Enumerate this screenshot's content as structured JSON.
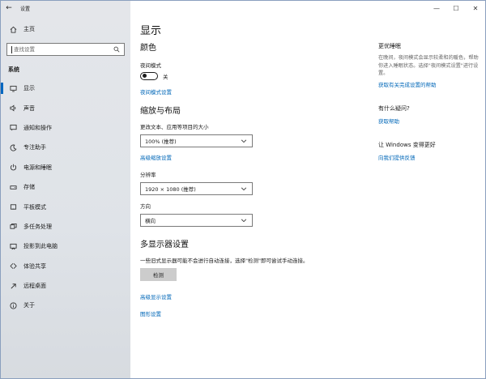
{
  "window": {
    "app_title": "设置",
    "controls": {
      "minimize": "—",
      "maximize": "☐",
      "close": "✕"
    }
  },
  "sidebar": {
    "back_glyph": "←",
    "home_label": "主页",
    "search": {
      "placeholder": "查找设置"
    },
    "section_label": "系统",
    "items": [
      {
        "label": "显示",
        "icon": "monitor-icon",
        "active": true
      },
      {
        "label": "声音",
        "icon": "speaker-icon"
      },
      {
        "label": "通知和操作",
        "icon": "notification-icon"
      },
      {
        "label": "专注助手",
        "icon": "moon-icon"
      },
      {
        "label": "电源和睡眠",
        "icon": "power-icon"
      },
      {
        "label": "存储",
        "icon": "storage-icon"
      },
      {
        "label": "平板模式",
        "icon": "tablet-icon"
      },
      {
        "label": "多任务处理",
        "icon": "multitask-icon"
      },
      {
        "label": "投影到此电脑",
        "icon": "project-icon"
      },
      {
        "label": "体验共享",
        "icon": "share-icon"
      },
      {
        "label": "远程桌面",
        "icon": "remote-icon"
      },
      {
        "label": "关于",
        "icon": "info-icon"
      }
    ]
  },
  "main": {
    "page_title": "显示",
    "color_section": {
      "title": "颜色",
      "night_light_label": "夜间模式",
      "night_light_state": "关",
      "night_light_settings_link": "夜间模式设置"
    },
    "scale_section": {
      "title": "缩放与布局",
      "scale_label": "更改文本、应用等项目的大小",
      "scale_value": "100% (推荐)",
      "advanced_scale_link": "高级缩放设置",
      "resolution_label": "分辨率",
      "resolution_value": "1920 × 1080 (推荐)",
      "orientation_label": "方向",
      "orientation_value": "横向"
    },
    "multi_display": {
      "title": "多显示器设置",
      "description": "一些旧式显示器可能不会进行自动连接，选择\"检测\"即可尝试手动连接。",
      "detect_button": "检测",
      "advanced_display_link": "高级显示设置",
      "graphics_link": "图形设置"
    }
  },
  "aside": {
    "sleep_heading": "更优睡眠",
    "sleep_text": "在晚间，夜间模式会显示较柔和的暖色，帮助你进入睡眠状态。选择\"夜间模式设置\"进行设置。",
    "sleep_link": "获取有关完成设置的帮助",
    "question_heading": "有什么疑问?",
    "help_link": "获取帮助",
    "improve_heading": "让 Windows 变得更好",
    "feedback_link": "向我们提供反馈"
  }
}
